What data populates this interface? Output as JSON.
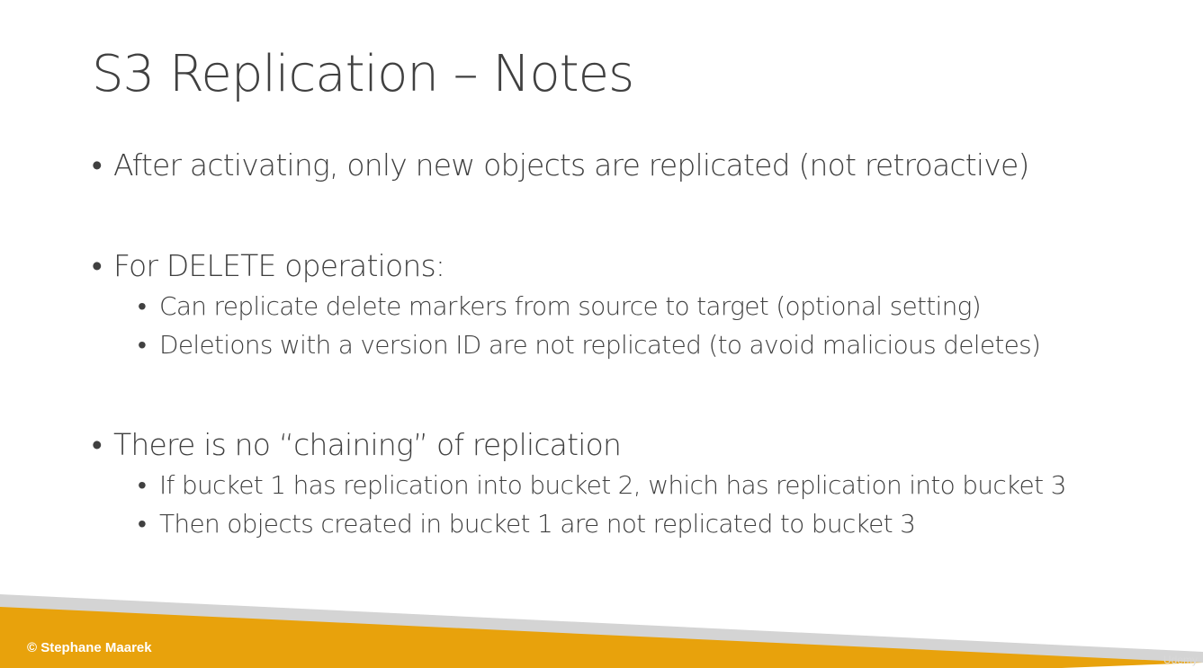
{
  "slide": {
    "title": "S3 Replication – Notes",
    "bullets": [
      {
        "text": "After activating, only new objects are replicated (not retroactive)"
      },
      {
        "text": "For DELETE operations:"
      },
      {
        "text": "Can replicate delete markers from source to target (optional setting)"
      },
      {
        "text": "Deletions with a version ID are not replicated (to avoid malicious deletes)"
      },
      {
        "text": "There is no “chaining” of replication"
      },
      {
        "text": "If bucket 1 has replication into bucket 2, which has replication into bucket 3"
      },
      {
        "text": "Then objects created in bucket 1 are not replicated to bucket 3"
      }
    ],
    "bullet_glyph": "•"
  },
  "footer": {
    "copyright": "© Stephane Maarek",
    "watermark": "Udemy",
    "accent_color": "#E8A20C",
    "stripe_color": "#D4D4D4"
  }
}
